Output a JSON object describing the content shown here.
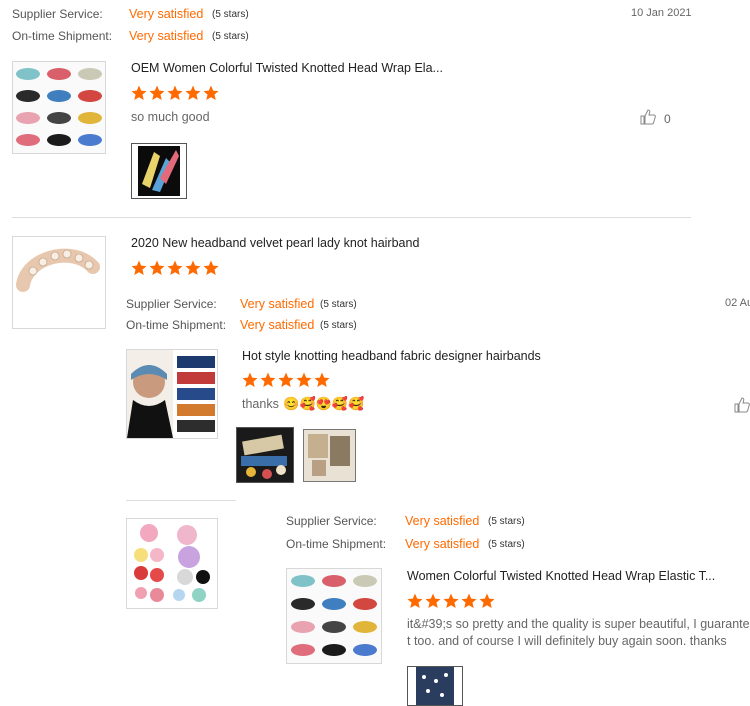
{
  "review1": {
    "supplier_service_label": "Supplier Service:",
    "supplier_service_value": "Very satisfied",
    "supplier_service_stars": "(5 stars)",
    "shipment_label": "On-time Shipment:",
    "shipment_value": "Very satisfied",
    "shipment_stars": "(5 stars)",
    "date": "10 Jan 2021",
    "product_title": "OEM Women Colorful Twisted Knotted Head Wrap Ela...",
    "rating": 5,
    "comment": "so much good",
    "like_count": "0"
  },
  "review2": {
    "product_title": "2020 New headband velvet pearl lady knot hairband",
    "rating": 5
  },
  "review3": {
    "supplier_service_label": "Supplier Service:",
    "supplier_service_value": "Very satisfied",
    "supplier_service_stars": "(5 stars)",
    "shipment_label": "On-time Shipment:",
    "shipment_value": "Very satisfied",
    "shipment_stars": "(5 stars)",
    "date": "02 Au",
    "product_title": "Hot style knotting headband fabric designer hairbands",
    "rating": 5,
    "comment": "thanks",
    "emoji": "😊🥰😍🥰🥰"
  },
  "review4": {
    "supplier_service_label": "Supplier Service:",
    "supplier_service_value": "Very satisfied",
    "supplier_service_stars": "(5 stars)",
    "shipment_label": "On-time Shipment:",
    "shipment_value": "Very satisfied",
    "shipment_stars": "(5 stars)",
    "product_title": "Women Colorful Twisted Knotted Head Wrap Elastic T...",
    "rating": 5,
    "comment_line1": "it&#39;s so pretty and the quality is super beautiful, I guarante",
    "comment_line2": "t too. and of course I  will definitely buy again soon. thanks"
  },
  "colors": {
    "accent": "#ff6a00",
    "text": "#333333",
    "muted": "#666666"
  },
  "icons": {
    "star": "star-icon",
    "like": "thumbs-up-icon"
  }
}
